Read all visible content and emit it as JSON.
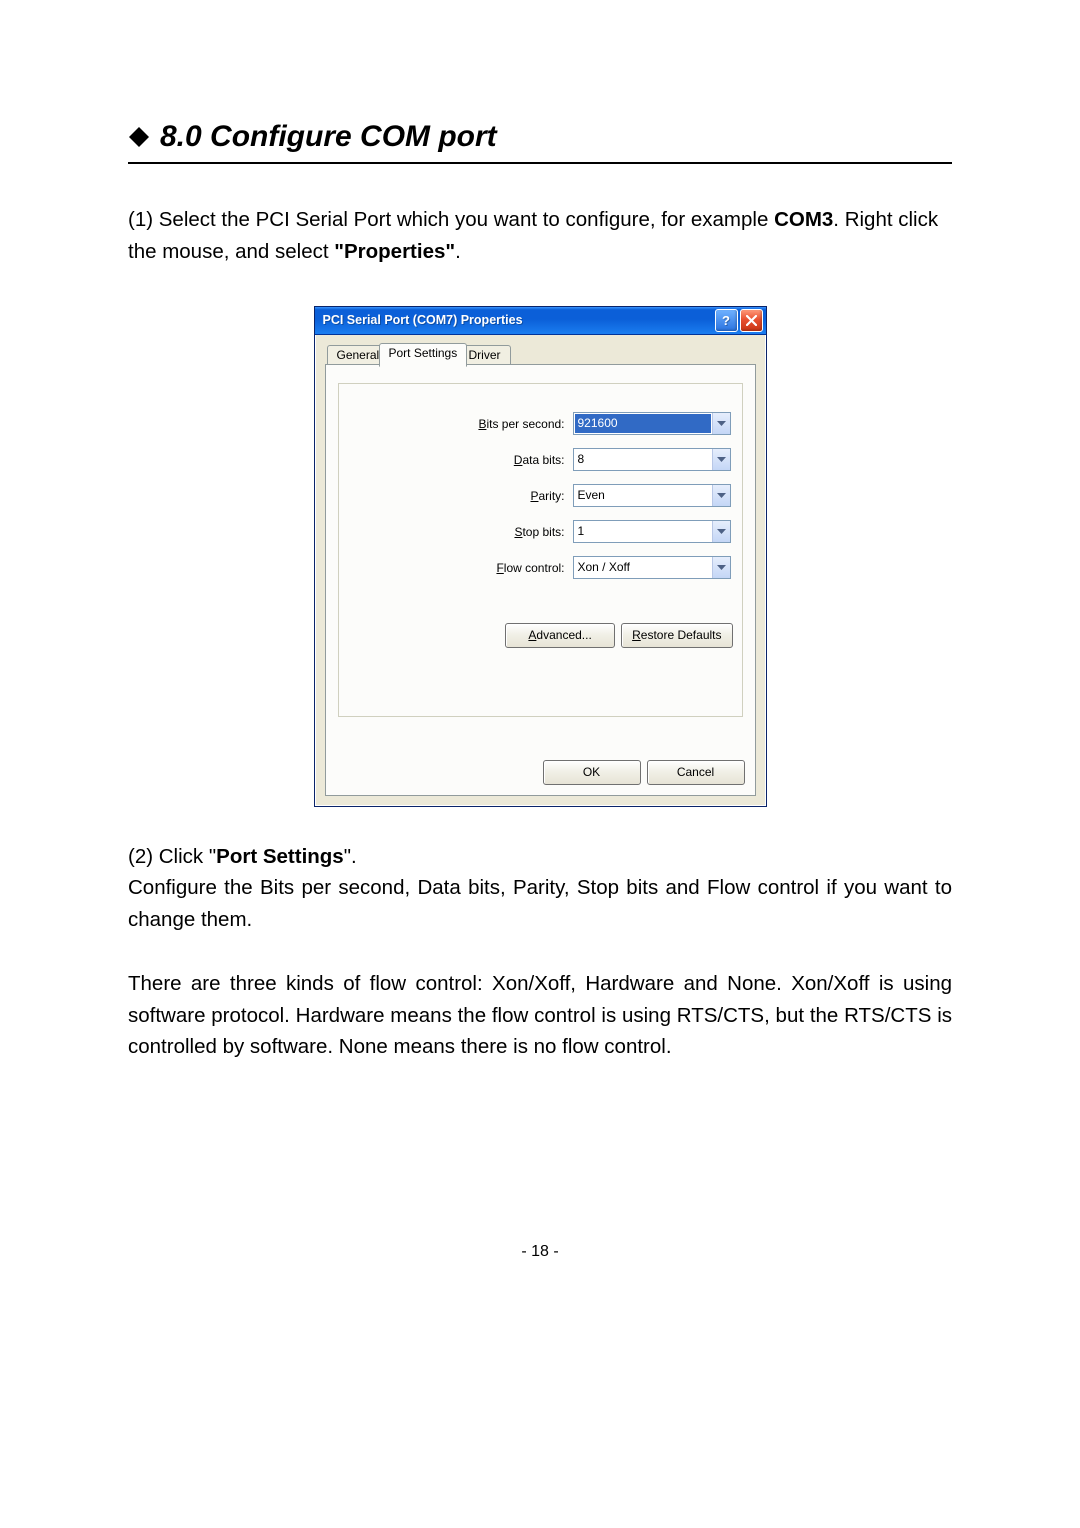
{
  "section_title": "8.0 Configure COM port",
  "para1_pre": "(1)  Select the PCI Serial Port which you want to configure, for example ",
  "para1_bold1": "COM3",
  "para1_mid": ". Right click the mouse, and select ",
  "para1_bold2": "\"Properties\"",
  "para1_post": ".",
  "dialog": {
    "title": "PCI Serial Port (COM7) Properties",
    "tabs": {
      "general": "General",
      "port_settings": "Port Settings",
      "driver": "Driver"
    },
    "fields": {
      "bps": {
        "label_u": "B",
        "label_rest": "its per second:",
        "value": "921600"
      },
      "data": {
        "label_u": "D",
        "label_rest": "ata bits:",
        "value": "8"
      },
      "parity": {
        "label_u": "P",
        "label_rest": "arity:",
        "value": "Even"
      },
      "stop": {
        "label_u": "S",
        "label_rest": "top bits:",
        "value": "1"
      },
      "flow": {
        "label_u": "F",
        "label_rest": "low control:",
        "value": "Xon / Xoff"
      }
    },
    "advanced_u": "A",
    "advanced_rest": "dvanced...",
    "restore_u": "R",
    "restore_rest": "estore Defaults",
    "ok": "OK",
    "cancel": "Cancel"
  },
  "para2_a": "(2) Click \"",
  "para2_bold": "Port Settings",
  "para2_b": "\".",
  "para3": "Configure the Bits per second, Data bits, Parity, Stop bits and Flow control if you want to change them.",
  "para4": "There are three kinds of flow control: Xon/Xoff, Hardware and None. Xon/Xoff is using software protocol. Hardware means the flow control is using RTS/CTS, but the RTS/CTS is controlled by software. None means there is no flow control.",
  "page_number": "- 18 -"
}
